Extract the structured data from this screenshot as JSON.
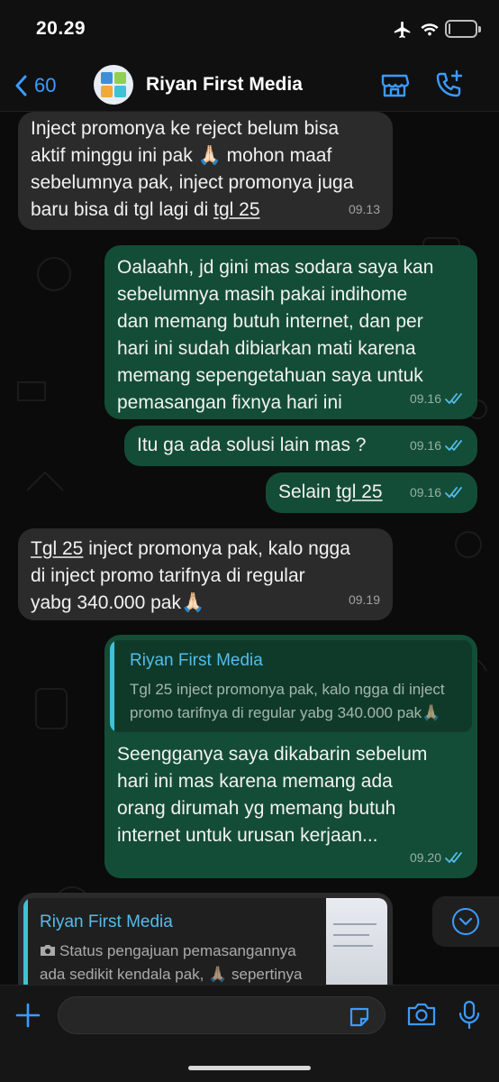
{
  "status_bar": {
    "time": "20.29",
    "battery": "7",
    "battery_level": 0.07,
    "icons": [
      "airplane-icon",
      "wifi-icon",
      "battery-icon"
    ]
  },
  "header": {
    "back_count": "60",
    "contact_name": "Riyan First Media",
    "icons": [
      "chevron-left-icon",
      "store-icon",
      "phone-add-icon"
    ],
    "accent_color": "#3b9bff"
  },
  "messages": [
    {
      "direction": "in",
      "lines": [
        "Inject promonya ke reject belum bisa",
        "aktif minggu ini pak 🙏🏻 mohon maaf",
        "sebelumnya pak, inject promonya juga",
        "baru bisa di tgl lagi di "
      ],
      "link": "tgl 25",
      "time": "09.13"
    },
    {
      "direction": "out",
      "lines": [
        "Oalaahh, jd gini mas sodara saya kan",
        "sebelumnya masih pakai indihome",
        "dan memang butuh internet, dan per",
        "hari ini sudah dibiarkan mati karena",
        "memang sepengetahuan saya untuk",
        "pemasangan fixnya hari ini"
      ],
      "time": "09.16",
      "read": true
    },
    {
      "direction": "out",
      "text": "Itu ga ada solusi lain mas ?",
      "time": "09.16",
      "read": true
    },
    {
      "direction": "out",
      "prefix": "Selain ",
      "link": "tgl 25",
      "time": "09.16",
      "read": true
    },
    {
      "direction": "in",
      "link": "Tgl 25",
      "lines": [
        " inject promonya pak, kalo ngga",
        "di inject promo tarifnya di regular",
        "yabg 340.000 pak🙏🏻"
      ],
      "time": "09.19"
    },
    {
      "direction": "out",
      "quote": {
        "name": "Riyan First Media",
        "text": "Tgl 25 inject promonya pak, kalo ngga di inject promo tarifnya di regular yabg 340.000 pak🙏🏻"
      },
      "lines": [
        "Seengganya saya dikabarin sebelum",
        "hari ini mas karena memang ada",
        "orang dirumah yg memang butuh",
        "internet untuk urusan kerjaan..."
      ],
      "time": "09.20",
      "read": true
    },
    {
      "direction": "in",
      "quote": {
        "name": "Riyan First Media",
        "text": "Status pengajuan pemasangannya ada sedikit kendala pak, 🙏🏻 sepertinya membutuhkan tiang Calu"
      }
    }
  ],
  "colors": {
    "incoming_bubble": "#2b2b2b",
    "outgoing_bubble": "#144d37",
    "read_ticks": "#53bdeb",
    "quote_name": "#53bdeb",
    "quote_bar": "#3ec3d6"
  },
  "input_bar": {
    "message_placeholder": "",
    "icons": [
      "plus-icon",
      "sticker-icon",
      "camera-icon",
      "mic-icon"
    ]
  }
}
